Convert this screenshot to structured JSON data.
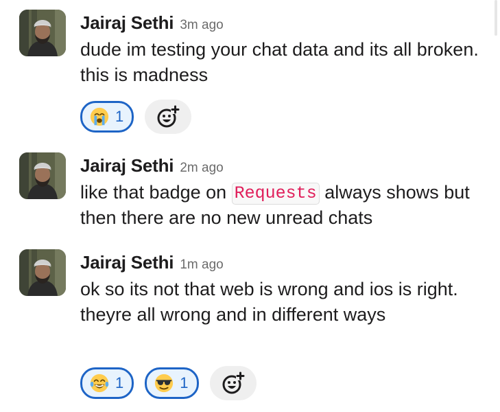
{
  "messages": [
    {
      "sender": "Jairaj Sethi",
      "time": "3m ago",
      "text": "dude im testing your chat data and its all broken. this is madness",
      "reactions": [
        {
          "emoji": "crying-face",
          "count": "1"
        }
      ]
    },
    {
      "sender": "Jairaj Sethi",
      "time": "2m ago",
      "text_before": "like that badge on ",
      "code": "Requests",
      "text_after": " always shows but then there are no new unread chats"
    },
    {
      "sender": "Jairaj Sethi",
      "time": "1m ago",
      "text": "ok so its not that web is wrong and ios is right. theyre all wrong and in different ways",
      "reactions": [
        {
          "emoji": "tears-of-joy-face",
          "count": "1"
        },
        {
          "emoji": "sunglasses-face",
          "count": "1"
        }
      ]
    }
  ],
  "colors": {
    "reaction_border": "#1d64c6",
    "reaction_bg": "#e8f3fd",
    "code_text": "#e01e5a"
  },
  "icons": {
    "add_reaction": "add-reaction-smiley-icon"
  }
}
